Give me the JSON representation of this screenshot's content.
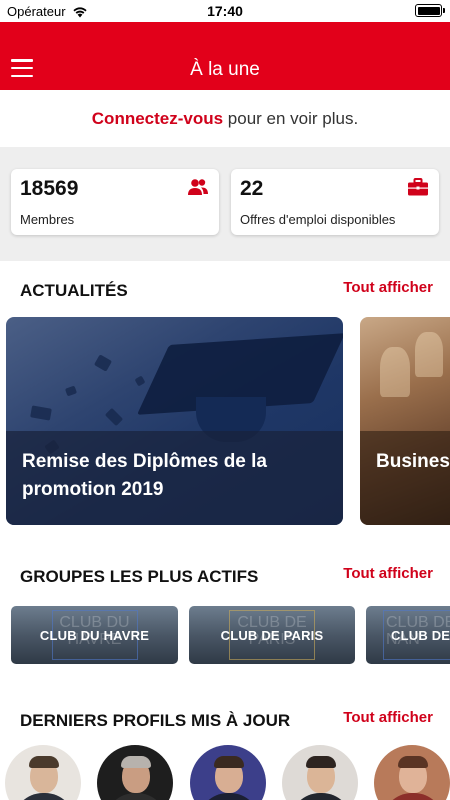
{
  "status_bar": {
    "carrier": "Opérateur",
    "time": "17:40"
  },
  "nav": {
    "title": "À la une"
  },
  "connect": {
    "link_text": "Connectez-vous",
    "rest_text": " pour en voir plus."
  },
  "stats": [
    {
      "value": "18569",
      "label": "Membres",
      "icon": "users-icon"
    },
    {
      "value": "22",
      "label": "Offres d'emploi disponibles",
      "icon": "briefcase-icon"
    }
  ],
  "news": {
    "title": "ACTUALITÉS",
    "see_all": "Tout afficher",
    "items": [
      {
        "title": "Remise des Diplômes de la promotion 2019"
      },
      {
        "title": "Business !"
      }
    ]
  },
  "groups": {
    "title": "GROUPES LES PLUS ACTIFS",
    "see_all": "Tout afficher",
    "items": [
      {
        "name": "CLUB DU HAVRE",
        "bg": "CLUB DU\nHAVRE"
      },
      {
        "name": "CLUB DE PARIS",
        "bg": "CLUB DE\nPARIS"
      },
      {
        "name": "CLUB DE",
        "bg": "CLUB DE\nNAN"
      }
    ]
  },
  "profiles": {
    "title": "DERNIERS PROFILS MIS À JOUR",
    "see_all": "Tout afficher"
  },
  "colors": {
    "brand_red": "#e2001a",
    "link_red": "#d0021b",
    "stats_bg": "#eeeeee"
  }
}
